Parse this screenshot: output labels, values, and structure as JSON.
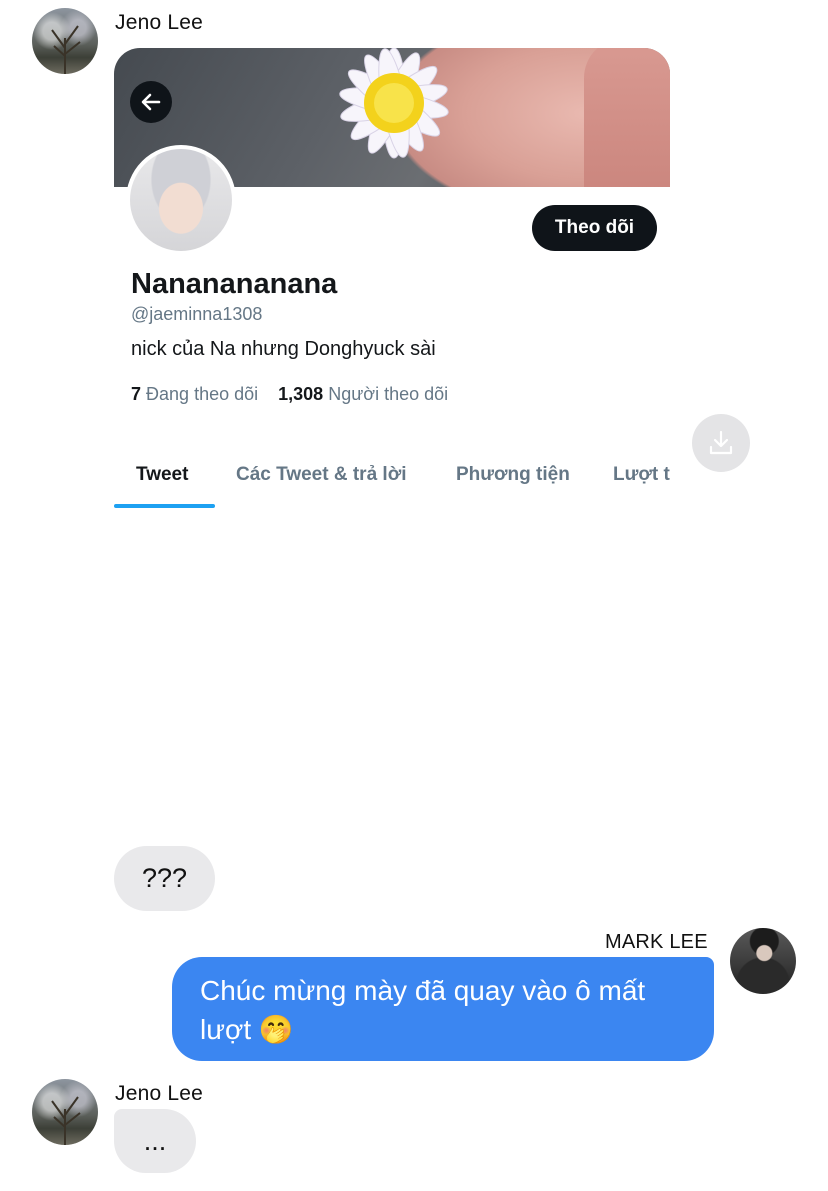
{
  "messages": {
    "first_sender": "Jeno Lee",
    "question_text": "???",
    "reply_sender": "MARK LEE",
    "reply_text": "Chúc mừng mày đã quay vào ô mất lượt 🤭",
    "last_sender": "Jeno Lee",
    "last_text": "..."
  },
  "profile": {
    "follow_label": "Theo dõi",
    "display_name": "Nananananana",
    "handle": "@jaeminna1308",
    "bio": "nick của Na nhưng Donghyuck sài",
    "following_count": "7",
    "following_label": "Đang theo dõi",
    "followers_count": "1,308",
    "followers_label": "Người theo dõi",
    "tabs": [
      "Tweet",
      "Các Tweet & trả lời",
      "Phương tiện",
      "Lượt t"
    ]
  },
  "icons": {
    "back": "arrow-left-icon",
    "download": "download-icon"
  },
  "colors": {
    "accent": "#1da1f2",
    "bubble_blue": "#3b86f1",
    "bubble_gray": "#e9e9eb"
  }
}
